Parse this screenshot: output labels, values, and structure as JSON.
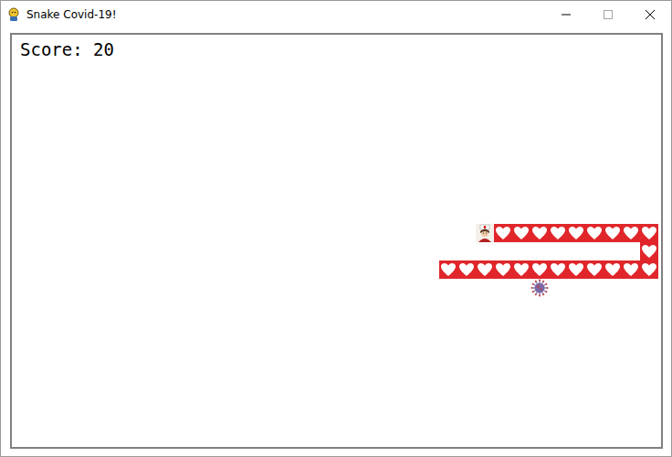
{
  "window": {
    "title": "Snake Covid-19!"
  },
  "score": "Score: 20",
  "snake": [
    {
      "kind": "head",
      "col": 26,
      "row": 12
    },
    {
      "kind": "body",
      "col": 27,
      "row": 12
    },
    {
      "kind": "body",
      "col": 28,
      "row": 12
    },
    {
      "kind": "body",
      "col": 29,
      "row": 12
    },
    {
      "kind": "body",
      "col": 30,
      "row": 12
    },
    {
      "kind": "body",
      "col": 31,
      "row": 12
    },
    {
      "kind": "body",
      "col": 32,
      "row": 12
    },
    {
      "kind": "body",
      "col": 33,
      "row": 12
    },
    {
      "kind": "body",
      "col": 34,
      "row": 12
    },
    {
      "kind": "body",
      "col": 35,
      "row": 12
    },
    {
      "kind": "body",
      "col": 35,
      "row": 13
    },
    {
      "kind": "body",
      "col": 35,
      "row": 14
    },
    {
      "kind": "body",
      "col": 34,
      "row": 14
    },
    {
      "kind": "body",
      "col": 33,
      "row": 14
    },
    {
      "kind": "body",
      "col": 32,
      "row": 14
    },
    {
      "kind": "body",
      "col": 31,
      "row": 14
    },
    {
      "kind": "body",
      "col": 30,
      "row": 14
    },
    {
      "kind": "body",
      "col": 29,
      "row": 14
    },
    {
      "kind": "body",
      "col": 28,
      "row": 14
    },
    {
      "kind": "body",
      "col": 27,
      "row": 14
    },
    {
      "kind": "body",
      "col": 26,
      "row": 14
    },
    {
      "kind": "body",
      "col": 25,
      "row": 14
    },
    {
      "kind": "body",
      "col": 24,
      "row": 14
    }
  ],
  "virus": {
    "col": 29,
    "row": 15
  }
}
